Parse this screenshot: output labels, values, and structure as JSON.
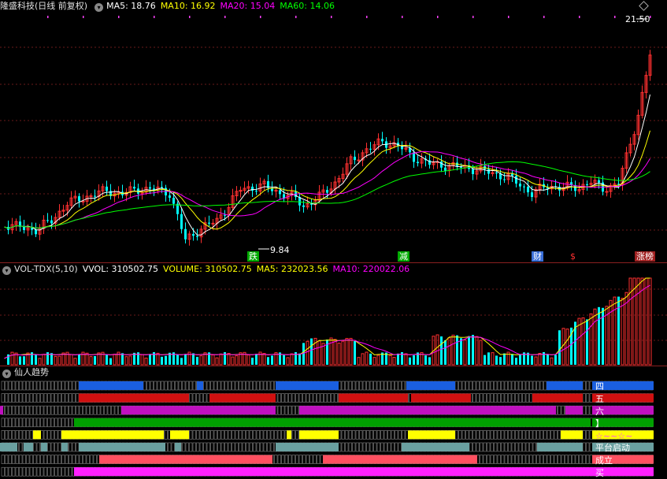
{
  "main": {
    "title": "隆盛科技",
    "title_suffix": "(日线 前复权)",
    "ma": [
      {
        "label": "MA5: 18.76",
        "color": "#ffffff"
      },
      {
        "label": "MA10: 16.92",
        "color": "#ffff00"
      },
      {
        "label": "MA20: 15.04",
        "color": "#ff00ff"
      },
      {
        "label": "MA60: 14.06",
        "color": "#00ff00"
      }
    ],
    "high_label": "21.50",
    "low_label": "9.84",
    "markers": [
      {
        "text": "跌",
        "color": "#00aa00"
      },
      {
        "text": "减",
        "color": "#00aa00"
      },
      {
        "text": "财",
        "color": "#3a6fd8"
      },
      {
        "text": "$",
        "color": "#ff3030"
      },
      {
        "text": "涨榜",
        "color": "#ff3030"
      }
    ]
  },
  "volume": {
    "title": "VOL-TDX(5,10)",
    "items": [
      {
        "label": "VVOL: 310502.75",
        "color": "#ffffff"
      },
      {
        "label": "VOLUME: 310502.75",
        "color": "#ffff00"
      },
      {
        "label": "MA5: 232023.56",
        "color": "#ffff00"
      },
      {
        "label": "MA10: 220022.06",
        "color": "#ff00ff"
      }
    ]
  },
  "indicator": {
    "title": "仙人趋势",
    "strips": [
      {
        "label": "四",
        "color": "#1a5fe0"
      },
      {
        "label": "五",
        "color": "#d01010"
      },
      {
        "label": "六",
        "color": "#c010c0"
      },
      {
        "label": "】",
        "color": "#00a000"
      },
      {
        "label": "☆~~☆~",
        "color": "#ffff00"
      },
      {
        "label": "平台启动",
        "color": "#6aa0a0"
      },
      {
        "label": "成立",
        "color": "#ff5060"
      },
      {
        "label": "买",
        "color": "#ff20ff"
      }
    ]
  }
}
